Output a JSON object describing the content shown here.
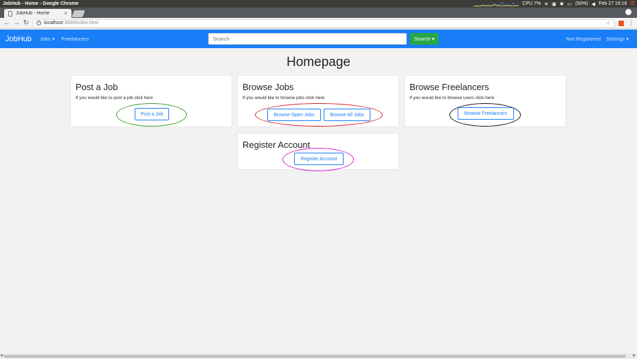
{
  "os_bar": {
    "window_title": "JobHub - Home - Google Chrome",
    "cpu": "CPU 7%",
    "battery": "(50%)",
    "datetime": "Feb 27 16:16"
  },
  "browser": {
    "tab_title": "JobHub - Home",
    "tab_close": "×",
    "url_host": "localhost",
    "url_path": ":3000/index.html"
  },
  "navbar": {
    "brand": "JobHub",
    "jobs": "Jobs ▾",
    "freelancers": "Freelancers",
    "search_placeholder": "Search",
    "search_button": "Search ▾",
    "not_registered": "Not Registered",
    "settings": "Settings ▾"
  },
  "page": {
    "title": "Homepage"
  },
  "cards": {
    "post_job": {
      "title": "Post a Job",
      "text": "If you would like to post a job click here",
      "button": "Post a Job"
    },
    "browse_jobs": {
      "title": "Browse Jobs",
      "text": "If you would like to browse jobs click here",
      "button_open": "Browse Open Jobs",
      "button_all": "Browse All Jobs"
    },
    "browse_freelancers": {
      "title": "Browse Freelancers",
      "text": "If you would like to browse users click here",
      "button": "Browse Freelancers"
    },
    "register": {
      "title": "Register Account",
      "button": "Register Account"
    }
  },
  "annotations": {
    "post_job_color": "#3a9a2a",
    "browse_jobs_color": "#d81f1f",
    "browse_freelancers_color": "#111111",
    "register_color": "#d61fd6"
  }
}
